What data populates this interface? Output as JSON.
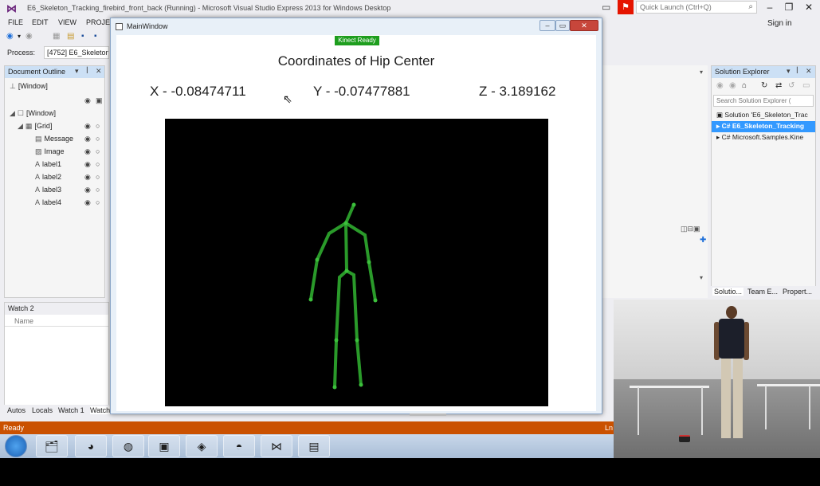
{
  "vs": {
    "title": "E6_Skeleton_Tracking_firebird_front_back (Running) - Microsoft Visual Studio Express 2013 for Windows Desktop",
    "quick_launch_placeholder": "Quick Launch (Ctrl+Q)",
    "sign_in": "Sign in",
    "menu": [
      "FILE",
      "EDIT",
      "VIEW",
      "PROJEC"
    ],
    "process_label": "Process:",
    "process_value": "[4752] E6_Skeleton_",
    "status": "Ready",
    "status_right": "Ln"
  },
  "document_outline": {
    "title": "Document Outline",
    "root": "[Window]",
    "window_node": "[Window]",
    "grid_node": "[Grid]",
    "children": [
      "Message",
      "Image",
      "label1",
      "label2",
      "label3",
      "label4"
    ]
  },
  "watch": {
    "title": "Watch 2",
    "column": "Name",
    "tabs": [
      "Autos",
      "Locals",
      "Watch 1",
      "Watch"
    ]
  },
  "solution_explorer": {
    "title": "Solution Explorer",
    "search_placeholder": "Search Solution Explorer (",
    "rows": [
      "Solution 'E6_Skeleton_Trac",
      "E6_Skeleton_Tracking",
      "Microsoft.Samples.Kine"
    ],
    "tabs": [
      "Solutio...",
      "Team E...",
      "Propert..."
    ]
  },
  "main_window": {
    "title": "MainWindow",
    "kinect_status": "Kinect Ready",
    "heading": "Coordinates of Hip Center",
    "x_text": "X - -0.08474711",
    "y_text": "Y - -0.07477881",
    "z_text": "Z - 3.189162"
  },
  "colors": {
    "vs_status": "#ca5100",
    "kinect_ready": "#1e9e1e",
    "skeleton": "#2a9a2a",
    "selection": "#3399ff"
  }
}
